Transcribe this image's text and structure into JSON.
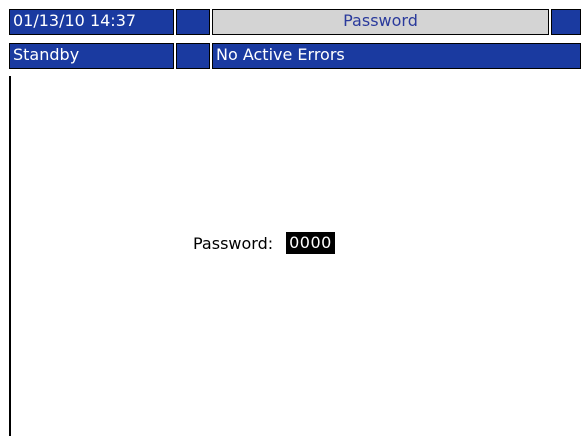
{
  "header": {
    "datetime": "01/13/10 14:37",
    "screen_title": "Password",
    "status": "Standby",
    "errors": "No Active Errors"
  },
  "main": {
    "password_label": "Password:",
    "password_value": "0000"
  },
  "colors": {
    "header_blue": "#1a3aa0",
    "title_grey": "#d4d4d4",
    "title_text": "#2a3a9c"
  }
}
